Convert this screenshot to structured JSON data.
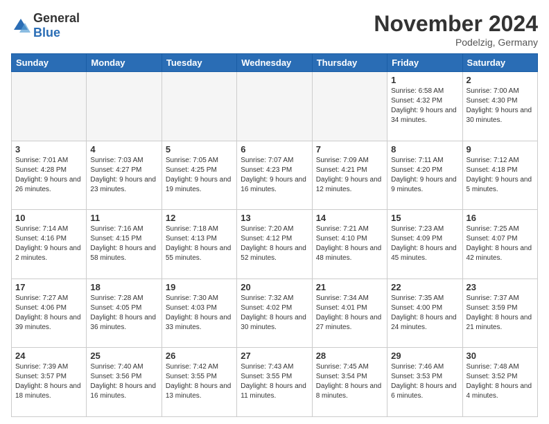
{
  "logo": {
    "general": "General",
    "blue": "Blue"
  },
  "header": {
    "month": "November 2024",
    "location": "Podelzig, Germany"
  },
  "weekdays": [
    "Sunday",
    "Monday",
    "Tuesday",
    "Wednesday",
    "Thursday",
    "Friday",
    "Saturday"
  ],
  "weeks": [
    [
      {
        "day": "",
        "empty": true
      },
      {
        "day": "",
        "empty": true
      },
      {
        "day": "",
        "empty": true
      },
      {
        "day": "",
        "empty": true
      },
      {
        "day": "",
        "empty": true
      },
      {
        "day": "1",
        "sunrise": "6:58 AM",
        "sunset": "4:32 PM",
        "daylight": "9 hours and 34 minutes."
      },
      {
        "day": "2",
        "sunrise": "7:00 AM",
        "sunset": "4:30 PM",
        "daylight": "9 hours and 30 minutes."
      }
    ],
    [
      {
        "day": "3",
        "sunrise": "7:01 AM",
        "sunset": "4:28 PM",
        "daylight": "9 hours and 26 minutes."
      },
      {
        "day": "4",
        "sunrise": "7:03 AM",
        "sunset": "4:27 PM",
        "daylight": "9 hours and 23 minutes."
      },
      {
        "day": "5",
        "sunrise": "7:05 AM",
        "sunset": "4:25 PM",
        "daylight": "9 hours and 19 minutes."
      },
      {
        "day": "6",
        "sunrise": "7:07 AM",
        "sunset": "4:23 PM",
        "daylight": "9 hours and 16 minutes."
      },
      {
        "day": "7",
        "sunrise": "7:09 AM",
        "sunset": "4:21 PM",
        "daylight": "9 hours and 12 minutes."
      },
      {
        "day": "8",
        "sunrise": "7:11 AM",
        "sunset": "4:20 PM",
        "daylight": "9 hours and 9 minutes."
      },
      {
        "day": "9",
        "sunrise": "7:12 AM",
        "sunset": "4:18 PM",
        "daylight": "9 hours and 5 minutes."
      }
    ],
    [
      {
        "day": "10",
        "sunrise": "7:14 AM",
        "sunset": "4:16 PM",
        "daylight": "9 hours and 2 minutes."
      },
      {
        "day": "11",
        "sunrise": "7:16 AM",
        "sunset": "4:15 PM",
        "daylight": "8 hours and 58 minutes."
      },
      {
        "day": "12",
        "sunrise": "7:18 AM",
        "sunset": "4:13 PM",
        "daylight": "8 hours and 55 minutes."
      },
      {
        "day": "13",
        "sunrise": "7:20 AM",
        "sunset": "4:12 PM",
        "daylight": "8 hours and 52 minutes."
      },
      {
        "day": "14",
        "sunrise": "7:21 AM",
        "sunset": "4:10 PM",
        "daylight": "8 hours and 48 minutes."
      },
      {
        "day": "15",
        "sunrise": "7:23 AM",
        "sunset": "4:09 PM",
        "daylight": "8 hours and 45 minutes."
      },
      {
        "day": "16",
        "sunrise": "7:25 AM",
        "sunset": "4:07 PM",
        "daylight": "8 hours and 42 minutes."
      }
    ],
    [
      {
        "day": "17",
        "sunrise": "7:27 AM",
        "sunset": "4:06 PM",
        "daylight": "8 hours and 39 minutes."
      },
      {
        "day": "18",
        "sunrise": "7:28 AM",
        "sunset": "4:05 PM",
        "daylight": "8 hours and 36 minutes."
      },
      {
        "day": "19",
        "sunrise": "7:30 AM",
        "sunset": "4:03 PM",
        "daylight": "8 hours and 33 minutes."
      },
      {
        "day": "20",
        "sunrise": "7:32 AM",
        "sunset": "4:02 PM",
        "daylight": "8 hours and 30 minutes."
      },
      {
        "day": "21",
        "sunrise": "7:34 AM",
        "sunset": "4:01 PM",
        "daylight": "8 hours and 27 minutes."
      },
      {
        "day": "22",
        "sunrise": "7:35 AM",
        "sunset": "4:00 PM",
        "daylight": "8 hours and 24 minutes."
      },
      {
        "day": "23",
        "sunrise": "7:37 AM",
        "sunset": "3:59 PM",
        "daylight": "8 hours and 21 minutes."
      }
    ],
    [
      {
        "day": "24",
        "sunrise": "7:39 AM",
        "sunset": "3:57 PM",
        "daylight": "8 hours and 18 minutes."
      },
      {
        "day": "25",
        "sunrise": "7:40 AM",
        "sunset": "3:56 PM",
        "daylight": "8 hours and 16 minutes."
      },
      {
        "day": "26",
        "sunrise": "7:42 AM",
        "sunset": "3:55 PM",
        "daylight": "8 hours and 13 minutes."
      },
      {
        "day": "27",
        "sunrise": "7:43 AM",
        "sunset": "3:55 PM",
        "daylight": "8 hours and 11 minutes."
      },
      {
        "day": "28",
        "sunrise": "7:45 AM",
        "sunset": "3:54 PM",
        "daylight": "8 hours and 8 minutes."
      },
      {
        "day": "29",
        "sunrise": "7:46 AM",
        "sunset": "3:53 PM",
        "daylight": "8 hours and 6 minutes."
      },
      {
        "day": "30",
        "sunrise": "7:48 AM",
        "sunset": "3:52 PM",
        "daylight": "8 hours and 4 minutes."
      }
    ]
  ]
}
